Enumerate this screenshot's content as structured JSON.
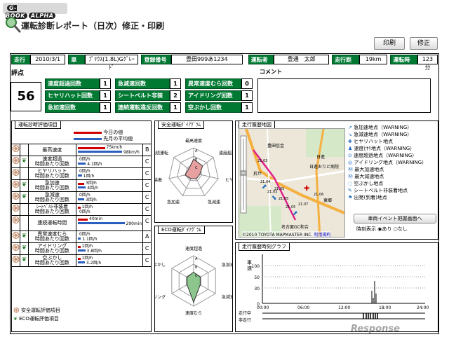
{
  "brand": {
    "name": "G-BOOK",
    "badge": "ALPHA"
  },
  "page_title": "運転診断レポート（日次）修正・印刷",
  "toolbar": {
    "print": "印刷",
    "edit": "修正"
  },
  "header": [
    {
      "label": "走行日",
      "value": "2010/3/1"
    },
    {
      "label": "車名",
      "value": "ﾌﾟﾘｳｽ(1.8L)Gｸﾞﾚｰﾄﾞ"
    },
    {
      "label": "登録番号",
      "value": "豊田999あ1234"
    },
    {
      "label": "運転者",
      "value": "豊通　太郎"
    },
    {
      "label": "走行距離",
      "value": "19km"
    },
    {
      "label": "運転時間",
      "value": "123分"
    }
  ],
  "score": {
    "title": "評点",
    "value": "56"
  },
  "comment": {
    "title": "コメント",
    "text": ""
  },
  "counts": [
    {
      "label": "速度超過回数",
      "value": "1"
    },
    {
      "label": "急減速回数",
      "value": "1"
    },
    {
      "label": "異常速度むら回数",
      "value": "0"
    },
    {
      "label": "ヒヤリハット回数",
      "value": "1"
    },
    {
      "label": "シートベルト非装着回数",
      "value": "2"
    },
    {
      "label": "アイドリング回数",
      "value": "1"
    },
    {
      "label": "急加速回数",
      "value": "1"
    },
    {
      "label": "連続運転違反回数",
      "value": "1"
    },
    {
      "label": "空ぶかし回数",
      "value": "1"
    }
  ],
  "eval": {
    "title": "運転診断評価項目",
    "legend_today": "今日の値",
    "legend_avg": "先月の平均値",
    "rows": [
      {
        "name": "最高速度",
        "v1": "75km/h",
        "v2": "98km/h",
        "f1": 0.55,
        "f2": 0.9,
        "grade": "B"
      },
      {
        "name": "速度超過\n時間あたり回数",
        "v1": "0回/h",
        "v2": "4.1回/h",
        "f1": 0.0,
        "f2": 0.16,
        "grade": "C"
      },
      {
        "name": "ヒヤリハット\n時間あたり回数",
        "v1": "0回/h",
        "v2": "1回/h",
        "f1": 0.0,
        "f2": 0.08,
        "grade": "C"
      },
      {
        "name": "急加速\n時間あたり回数",
        "v1": "3回/h",
        "v2": "4回/h",
        "f1": 0.13,
        "f2": 0.16,
        "grade": "C"
      },
      {
        "name": "急減速\n時間あたり回数",
        "v1": "0回/h",
        "v2": "3回/h",
        "f1": 0.0,
        "f2": 0.13,
        "grade": "C"
      },
      {
        "name": "ｼｰﾄﾍﾞﾙﾄ非装着\n時間あたり回数",
        "v1": "1回/h",
        "v2": "0回/h",
        "f1": 0.05,
        "f2": 0.0,
        "grade": "C"
      },
      {
        "name": "連続運転時間",
        "v1": "40min",
        "v2": "290min",
        "f1": 0.2,
        "f2": 0.95,
        "grade": "C"
      },
      {
        "name": "異常速度むら\n時間あたり回数",
        "v1": "0回/h",
        "v2": "1.1回/h",
        "f1": 0.0,
        "f2": 0.06,
        "grade": "A"
      },
      {
        "name": "アイドリング\n時間あたり回数",
        "v1": "1回/h",
        "v2": "3.8回/h",
        "f1": 0.05,
        "f2": 0.15,
        "grade": "C"
      },
      {
        "name": "空ぶかし\n時間あたり回数",
        "v1": "1回/h",
        "v2": "3.2回/h",
        "f1": 0.05,
        "f2": 0.14,
        "grade": "C"
      }
    ],
    "footer1": "安全運転評価項目",
    "footer2": "ECO運転評価項目"
  },
  "safety_radar": {
    "title": "安全運転ﾀﾞｲｱｸﾞﾗﾑ",
    "axes": [
      "最高速度",
      "速度超過",
      "ヒヤリハット",
      "急減速",
      "急加速",
      "シートベルト非装着",
      "連続運転"
    ],
    "letters": [
      "A",
      "B",
      "C"
    ],
    "levels": [
      0.55,
      0.45,
      0.25,
      0.25,
      0.25,
      0.35,
      0.25
    ]
  },
  "eco_radar": {
    "title": "ECO運転ﾀﾞｲｱｸﾞﾗﾑ",
    "axes": [
      "速度超過",
      "急加速",
      "急減速",
      "速度むら",
      "アイドリング",
      "空ぶかし"
    ],
    "letters": [
      "A",
      "B",
      "C"
    ],
    "levels": [
      0.35,
      0.3,
      0.3,
      0.85,
      0.3,
      0.3
    ]
  },
  "map": {
    "title": "走行履歴地図",
    "places": [
      "豊田信金",
      "日進",
      "日進おりど病院",
      "東郷",
      "名古屋GC和合",
      "折戸"
    ],
    "times": [
      "21.03",
      "21.04",
      "21.05",
      "21.06",
      "21.05",
      "21.03",
      "21.05",
      "21.07"
    ],
    "copyright": "©2010 TOYOTA MAPMASTER INC.",
    "terms": "利用規約",
    "legend": [
      {
        "icon": "↗",
        "text": "急加速地点（",
        "warn": "WARNING）"
      },
      {
        "icon": "↘",
        "text": "急減速地点（",
        "warn": "WARNING）"
      },
      {
        "icon": "✚",
        "text": "ヒヤリハット地点",
        "warn": ""
      },
      {
        "icon": "♟",
        "text": "速度ﾋﾔﾘ地点（",
        "warn": "WARNING）"
      },
      {
        "icon": "⊙",
        "text": "速度超過地点（",
        "warn": "WARNING）"
      },
      {
        "icon": "◎",
        "text": "アイドリング地点（",
        "warn": "WARNING）"
      },
      {
        "icon": "Ⓜ",
        "text": "最大加速地点",
        "warn": ""
      },
      {
        "icon": "Ⓜ",
        "text": "最大減速地点",
        "warn": ""
      },
      {
        "icon": "◌",
        "text": "空ぶかし地点",
        "warn": ""
      },
      {
        "icon": "✎",
        "text": "シートベルト非装着地点",
        "warn": ""
      },
      {
        "icon": "⚑",
        "text": "出発(到着)地点",
        "warn": ""
      }
    ],
    "event_button": "車両イベント把握画面へ",
    "time_display": "時刻表示",
    "opt_on": "あり",
    "opt_off": "なし"
  },
  "time_graph": {
    "title": "走行履歴時刻グラフ",
    "ylabel": "車速",
    "xticks": [
      "00:00",
      "06:00",
      "12:00",
      "18:00",
      "24:00"
    ],
    "row1": "走行中",
    "row2": "非走行"
  },
  "watermark": "Response"
}
